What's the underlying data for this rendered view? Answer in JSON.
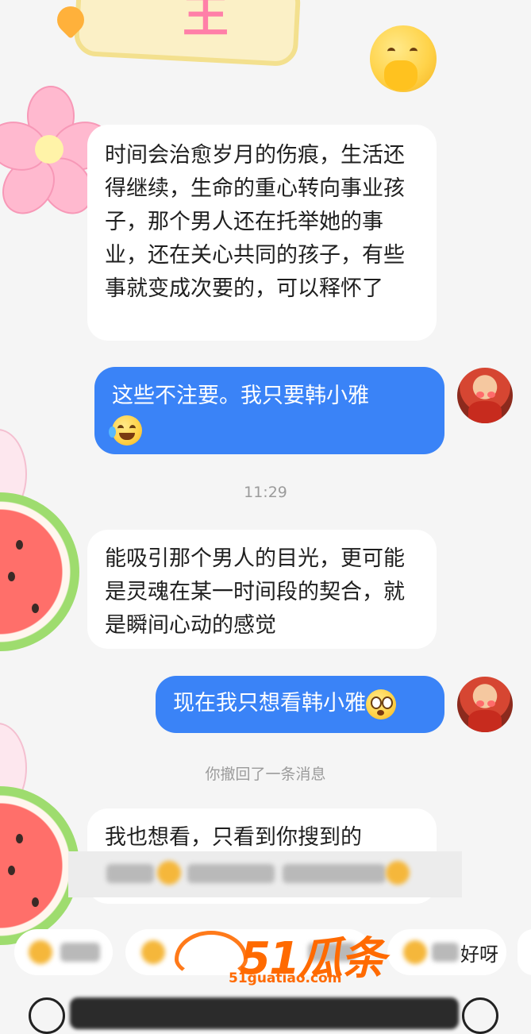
{
  "messages": [
    {
      "side": "left",
      "text": "时间会治愈岁月的伤痕，生活还得继续，生命的重心转向事业孩子，那个男人还在托举她的事业，还在关心共同的孩子，有些事就变成次要的，可以释怀了"
    },
    {
      "side": "right",
      "text": "这些不注要。我只要韩小雅",
      "emoji": "crying-laughing-emoji"
    },
    {
      "side": "time",
      "text": "11:29"
    },
    {
      "side": "left",
      "text": "能吸引那个男人的目光，更可能是灵魂在某一时间段的契合，就是瞬间心动的感觉"
    },
    {
      "side": "right",
      "text": "现在我只想看韩小雅",
      "emoji": "pleading-emoji"
    },
    {
      "side": "system",
      "text": "你撤回了一条消息"
    },
    {
      "side": "left",
      "text": "我也想看，只看到你搜到的"
    }
  ],
  "quick_replies": [
    "好呀"
  ],
  "watermark": {
    "main": "51瓜条",
    "sub": "51guatiao.com"
  },
  "colors": {
    "accent": "#3a83f7",
    "background": "#f5f5f5",
    "watermark": "#ff6a00"
  }
}
